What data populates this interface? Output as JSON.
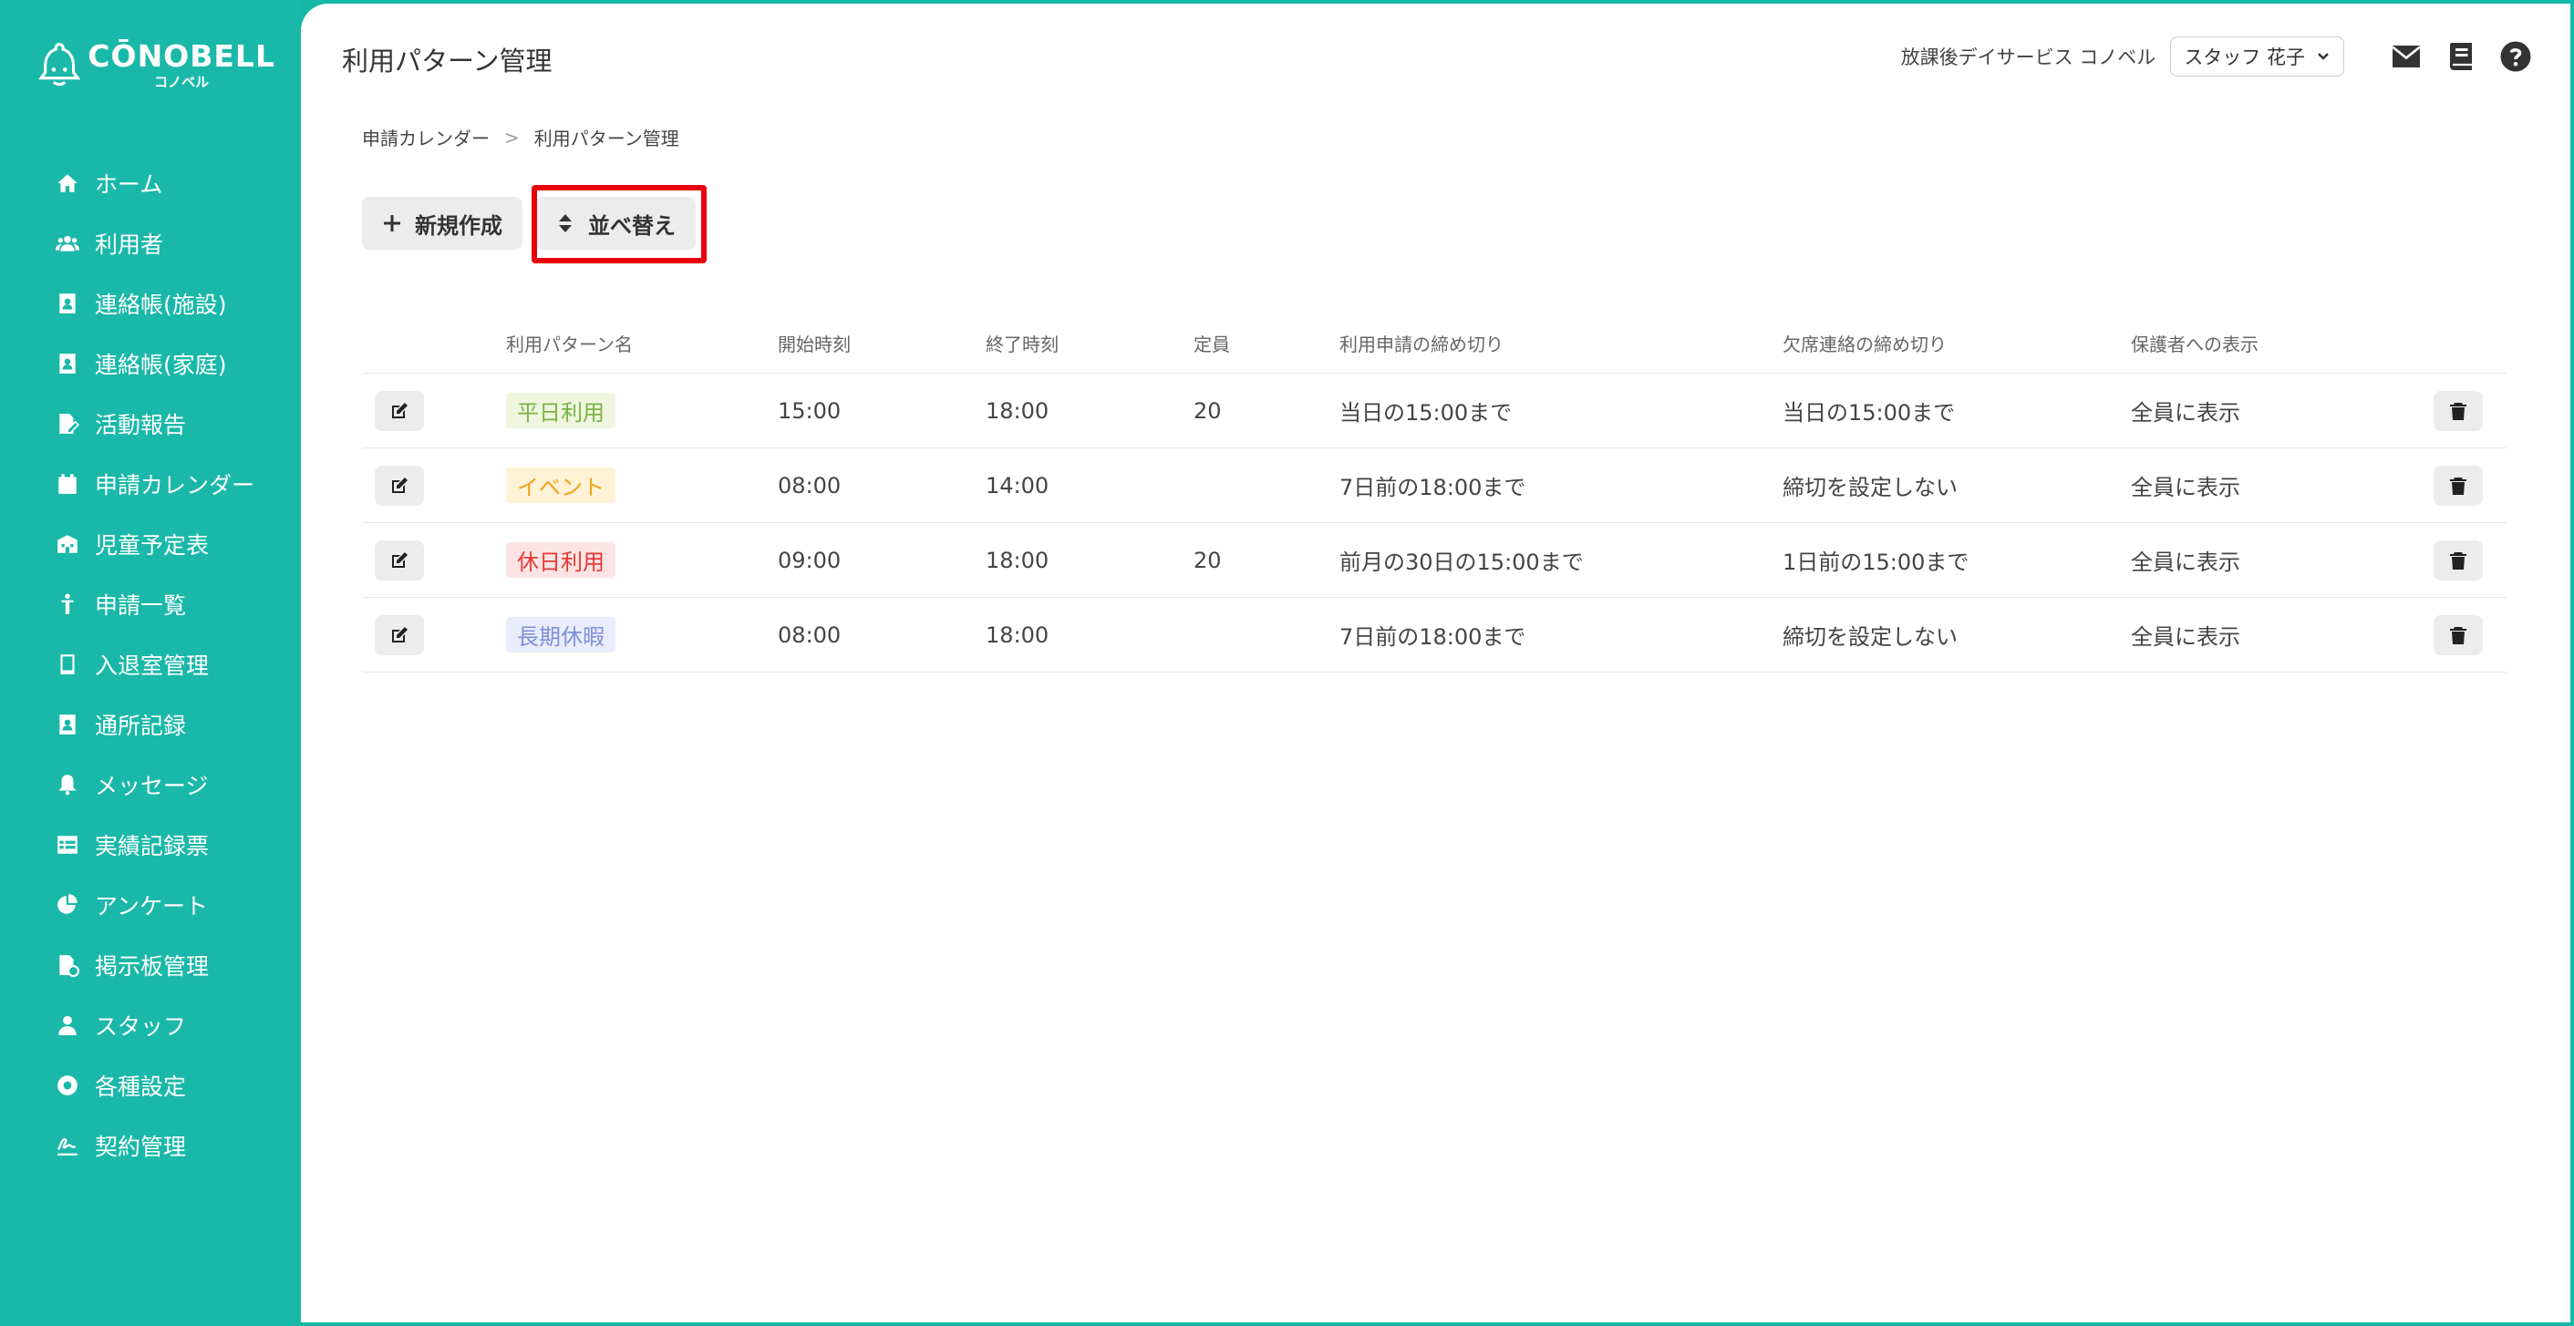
{
  "app": {
    "logo_main": "CŌNOBELL",
    "logo_sub": "コノベル"
  },
  "sidebar": {
    "items": [
      {
        "label": "ホーム",
        "icon": "home-icon"
      },
      {
        "label": "利用者",
        "icon": "users-icon"
      },
      {
        "label": "連絡帳(施設)",
        "icon": "contact-book-icon"
      },
      {
        "label": "連絡帳(家庭)",
        "icon": "contact-book-icon"
      },
      {
        "label": "活動報告",
        "icon": "report-icon"
      },
      {
        "label": "申請カレンダー",
        "icon": "calendar-icon"
      },
      {
        "label": "児童予定表",
        "icon": "schedule-icon"
      },
      {
        "label": "申請一覧",
        "icon": "child-icon"
      },
      {
        "label": "入退室管理",
        "icon": "tablet-icon"
      },
      {
        "label": "通所記録",
        "icon": "record-icon"
      },
      {
        "label": "メッセージ",
        "icon": "bell-icon"
      },
      {
        "label": "実績記録票",
        "icon": "table-icon"
      },
      {
        "label": "アンケート",
        "icon": "pie-chart-icon"
      },
      {
        "label": "掲示板管理",
        "icon": "board-icon"
      },
      {
        "label": "スタッフ",
        "icon": "staff-icon"
      },
      {
        "label": "各種設定",
        "icon": "gear-icon"
      },
      {
        "label": "契約管理",
        "icon": "signature-icon"
      }
    ]
  },
  "header": {
    "title": "利用パターン管理",
    "facility": "放課後デイサービス コノベル",
    "staff": "スタッフ 花子"
  },
  "breadcrumb": {
    "parent": "申請カレンダー",
    "sep": ">",
    "current": "利用パターン管理"
  },
  "toolbar": {
    "new_label": "新規作成",
    "sort_label": "並べ替え"
  },
  "table": {
    "headers": [
      "利用パターン名",
      "開始時刻",
      "終了時刻",
      "定員",
      "利用申請の締め切り",
      "欠席連絡の締め切り",
      "保護者への表示"
    ],
    "rows": [
      {
        "name": "平日利用",
        "start": "15:00",
        "end": "18:00",
        "capacity": "20",
        "apply_deadline": "当日の15:00まで",
        "absence_deadline": "当日の15:00まで",
        "display": "全員に表示",
        "tag_bg": "#eef6e0",
        "tag_fg": "#7cb342"
      },
      {
        "name": "イベント",
        "start": "08:00",
        "end": "14:00",
        "capacity": "",
        "apply_deadline": "7日前の18:00まで",
        "absence_deadline": "締切を設定しない",
        "display": "全員に表示",
        "tag_bg": "#fff2d6",
        "tag_fg": "#f2a31b"
      },
      {
        "name": "休日利用",
        "start": "09:00",
        "end": "18:00",
        "capacity": "20",
        "apply_deadline": "前月の30日の15:00まで",
        "absence_deadline": "1日前の15:00まで",
        "display": "全員に表示",
        "tag_bg": "#fde4e4",
        "tag_fg": "#e53935"
      },
      {
        "name": "長期休暇",
        "start": "08:00",
        "end": "18:00",
        "capacity": "",
        "apply_deadline": "7日前の18:00まで",
        "absence_deadline": "締切を設定しない",
        "display": "全員に表示",
        "tag_bg": "#e9ecfb",
        "tag_fg": "#7f8fd9"
      }
    ]
  }
}
